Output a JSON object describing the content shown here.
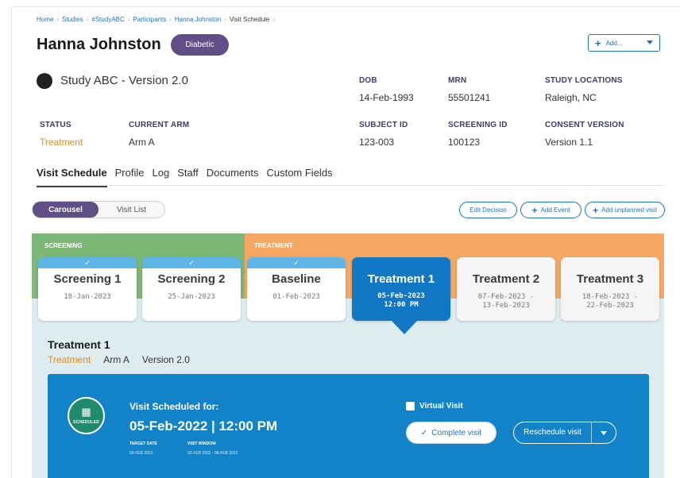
{
  "breadcrumb": [
    "Home",
    "Studies",
    "#StudyABC",
    "Participants",
    "Hanna Johnston",
    "Visit Schedule"
  ],
  "participant": {
    "name": "Hanna Johnston",
    "tag": "Diabetic"
  },
  "add_menu": {
    "label": "Add..."
  },
  "study": {
    "name": "Study ABC - Version 2.0"
  },
  "fields": {
    "dob": {
      "label": "DOB",
      "value": "14-Feb-1993"
    },
    "mrn": {
      "label": "MRN",
      "value": "55501241"
    },
    "locations": {
      "label": "STUDY LOCATIONS",
      "value": "Raleigh, NC"
    },
    "status": {
      "label": "STATUS",
      "value": "Treatment"
    },
    "arm": {
      "label": "CURRENT ARM",
      "value": "Arm A"
    },
    "subject_id": {
      "label": "SUBJECT ID",
      "value": "123-003"
    },
    "screening_id": {
      "label": "SCREENING ID",
      "value": "100123"
    },
    "consent": {
      "label": "CONSENT VERSION",
      "value": "Version 1.1"
    }
  },
  "tabs": [
    "Visit Schedule",
    "Profile",
    "Log",
    "Staff",
    "Documents",
    "Custom Fields"
  ],
  "view_toggle": [
    "Carousel",
    "Visit List"
  ],
  "actions": {
    "edit_decision": "Edit Decision",
    "add_event": "Add Event",
    "add_unplanned": "Add unplanned visit"
  },
  "phases": {
    "screening": "SCREENING",
    "treatment": "TREATMENT"
  },
  "visits": [
    {
      "name": "Screening 1",
      "date": "18-Jan-2023",
      "completed": true
    },
    {
      "name": "Screening 2",
      "date": "25-Jan-2023",
      "completed": true
    },
    {
      "name": "Baseline",
      "date": "01-Feb-2023",
      "completed": true
    },
    {
      "name": "Treatment 1",
      "date": "05-Feb-2023",
      "time": "12:00 PM",
      "active": true
    },
    {
      "name": "Treatment 2",
      "date_range": [
        "07-Feb-2023 -",
        "13-Feb-2023"
      ]
    },
    {
      "name": "Treatment 3",
      "date_range": [
        "18-Feb-2023 -",
        "22-Feb-2023"
      ]
    }
  ],
  "detail": {
    "title": "Treatment 1",
    "phase": "Treatment",
    "arm": "Arm A",
    "version": "Version 2.0",
    "icon_text": "SCHEDULED",
    "scheduled_label": "Visit Scheduled for:",
    "scheduled_datetime": "05-Feb-2022 | 12:00 PM",
    "target_date_label": "TARGET DATE",
    "target_date": "05-FEB 2022",
    "window_label": "VISIT WINDOW",
    "window": "02-FEB 2022 - 08-FEB 2022",
    "virtual_label": "Virtual Visit",
    "complete_label": "Complete visit",
    "reschedule_label": "Reschedule visit"
  },
  "colors": {
    "brand_purple": "#5f4f86",
    "link_blue": "#1a74c9",
    "active_blue": "#1277c4",
    "screening_green": "#7db876",
    "treatment_orange": "#f6a764",
    "status_orange": "#e88a1a"
  }
}
